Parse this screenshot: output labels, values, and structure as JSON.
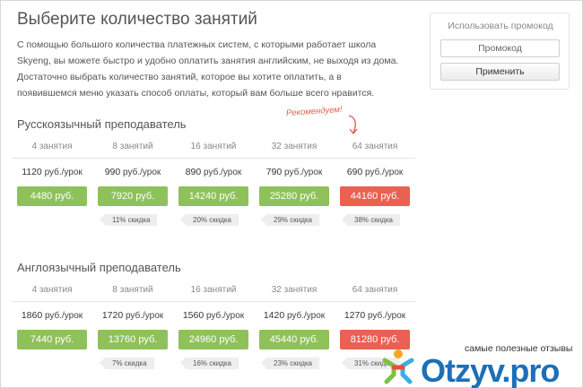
{
  "page": {
    "title": "Выберите количество занятий",
    "intro": "С помощью большого количества платежных систем, с которыми работает школа Skyeng, вы можете быстро и удобно оплатить занятия английским, не выходя из дома. Достаточно выбрать количество занятий, которое вы хотите оплатить, а в появившемся меню указать способ оплаты, который вам больше всего нравится."
  },
  "promo": {
    "title": "Использовать промокод",
    "placeholder": "Промокод",
    "apply_label": "Применить"
  },
  "recommend_label": "Рекомендуем!",
  "sections": [
    {
      "title": "Русскоязычный преподаватель",
      "plans": [
        {
          "header": "4 занятия",
          "price": "1120",
          "unit": "руб./урок",
          "total": "4480 руб.",
          "discount": "",
          "recommended": false
        },
        {
          "header": "8 занятий",
          "price": "990",
          "unit": "руб./урок",
          "total": "7920 руб.",
          "discount": "11% скидка",
          "recommended": false
        },
        {
          "header": "16 занятий",
          "price": "890",
          "unit": "руб./урок",
          "total": "14240 руб.",
          "discount": "20% скидка",
          "recommended": false
        },
        {
          "header": "32 занятия",
          "price": "790",
          "unit": "руб./урок",
          "total": "25280 руб.",
          "discount": "29% скидка",
          "recommended": false
        },
        {
          "header": "64 занятия",
          "price": "690",
          "unit": "руб./урок",
          "total": "44160 руб.",
          "discount": "38% скидка",
          "recommended": true
        }
      ]
    },
    {
      "title": "Англоязычный преподаватель",
      "plans": [
        {
          "header": "4 занятия",
          "price": "1860",
          "unit": "руб./урок",
          "total": "7440 руб.",
          "discount": "",
          "recommended": false
        },
        {
          "header": "8 занятий",
          "price": "1720",
          "unit": "руб./урок",
          "total": "13760 руб.",
          "discount": "7% скидка",
          "recommended": false
        },
        {
          "header": "16 занятий",
          "price": "1560",
          "unit": "руб./урок",
          "total": "24960 руб.",
          "discount": "16% скидка",
          "recommended": false
        },
        {
          "header": "32 занятия",
          "price": "1420",
          "unit": "руб./урок",
          "total": "45440 руб.",
          "discount": "23% скидка",
          "recommended": false
        },
        {
          "header": "64 занятия",
          "price": "1270",
          "unit": "руб./урок",
          "total": "81280 руб.",
          "discount": "31% скидка",
          "recommended": true
        }
      ]
    }
  ],
  "watermark": {
    "caption": "самые полезные отзывы",
    "brand": "Otzyv.pro"
  },
  "colors": {
    "buy_button": "#8ec15a",
    "recommended_button": "#ea6052",
    "brand_blue": "#1d6fb8"
  }
}
